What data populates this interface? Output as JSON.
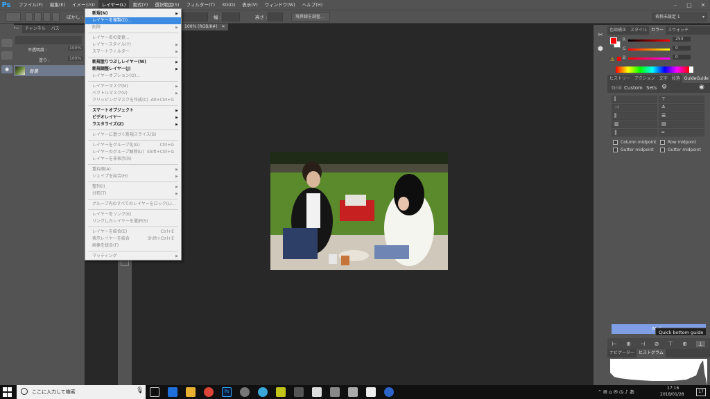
{
  "app": {
    "logo": "Ps",
    "menus": [
      "ファイル(F)",
      "編集(E)",
      "イメージ(I)",
      "レイヤー(L)",
      "書式(Y)",
      "選択範囲(S)",
      "フィルター(T)",
      "3D(D)",
      "表示(V)",
      "ウィンドウ(W)",
      "ヘルプ(H)"
    ],
    "active_menu": "レイヤー(L)"
  },
  "optbar": {
    "blur_label": "ぼかし :",
    "width_label": "幅 :",
    "height_label": "高さ :",
    "refine_edge": "境界線を調整...",
    "workspace": "名称未設定 1"
  },
  "left_panel": {
    "tabs": [
      "レイヤー",
      "チャンネル",
      "パス"
    ],
    "opacity_label": "不透明度 :",
    "opacity_value": "100%",
    "fill_label": "塗り :",
    "fill_value": "100%",
    "layer_name": "背景"
  },
  "document_tab": "100% (RGB/8#)",
  "layer_menu": {
    "items": [
      {
        "label": "新規(N)",
        "type": "bold",
        "arrow": true
      },
      {
        "label": "レイヤーを複製(D)...",
        "type": "hi"
      },
      {
        "label": "削除",
        "type": "dis",
        "arrow": true
      },
      {
        "type": "sep"
      },
      {
        "label": "レイヤー名の変更...",
        "type": "dis"
      },
      {
        "label": "レイヤースタイル(Y)",
        "type": "dis",
        "arrow": true
      },
      {
        "label": "スマートフィルター",
        "type": "dis",
        "arrow": true
      },
      {
        "type": "sep"
      },
      {
        "label": "新規塗りつぶしレイヤー(W)",
        "type": "bold",
        "arrow": true
      },
      {
        "label": "新規調整レイヤー(J)",
        "type": "bold",
        "arrow": true
      },
      {
        "label": "レイヤーオプション(O)...",
        "type": "dis"
      },
      {
        "type": "sep"
      },
      {
        "label": "レイヤーマスク(M)",
        "type": "dis",
        "arrow": true
      },
      {
        "label": "ベクトルマスク(V)",
        "type": "dis",
        "arrow": true
      },
      {
        "label": "クリッピングマスクを作成(C)",
        "type": "dis",
        "shortcut": "Alt+Ctrl+G"
      },
      {
        "type": "sep"
      },
      {
        "label": "スマートオブジェクト",
        "type": "bold",
        "arrow": true
      },
      {
        "label": "ビデオレイヤー",
        "type": "bold",
        "arrow": true
      },
      {
        "label": "ラスタライズ(Z)",
        "type": "bold",
        "arrow": true
      },
      {
        "type": "sep"
      },
      {
        "label": "レイヤーに基づく新規スライス(B)",
        "type": "dis"
      },
      {
        "type": "sep"
      },
      {
        "label": "レイヤーをグループ化(G)",
        "type": "dis",
        "shortcut": "Ctrl+G"
      },
      {
        "label": "レイヤーのグループ解除(U)",
        "type": "dis",
        "shortcut": "Shift+Ctrl+G"
      },
      {
        "label": "レイヤーを非表示(R)",
        "type": "dis"
      },
      {
        "type": "sep"
      },
      {
        "label": "重ね順(A)",
        "type": "dis",
        "arrow": true
      },
      {
        "label": "シェイプを結合(H)",
        "type": "dis",
        "arrow": true
      },
      {
        "type": "sep"
      },
      {
        "label": "整列(I)",
        "type": "dis",
        "arrow": true
      },
      {
        "label": "分布(T)",
        "type": "dis",
        "arrow": true
      },
      {
        "type": "sep"
      },
      {
        "label": "グループ内のすべてのレイヤーをロック(L)...",
        "type": "dis"
      },
      {
        "type": "sep"
      },
      {
        "label": "レイヤーをリンク(K)",
        "type": "dis"
      },
      {
        "label": "リンクしたレイヤーを選択(S)",
        "type": "dis"
      },
      {
        "type": "sep"
      },
      {
        "label": "レイヤーを結合(E)",
        "type": "dis",
        "shortcut": "Ctrl+E"
      },
      {
        "label": "表示レイヤーを結合",
        "type": "dis",
        "shortcut": "Shift+Ctrl+E"
      },
      {
        "label": "画像を統合(F)",
        "type": "dis"
      },
      {
        "type": "sep"
      },
      {
        "label": "マッティング",
        "type": "dis",
        "arrow": true
      }
    ]
  },
  "color_panel": {
    "tabs": [
      "色調補正",
      "スタイル",
      "カラー",
      "スウォッチ"
    ],
    "active_tab": "カラー",
    "r_label": "R",
    "r_value": "253",
    "g_label": "G",
    "g_value": "0",
    "b_label": "B",
    "b_value": "0",
    "foreground": "#fd0000"
  },
  "guide_panel": {
    "tabs": [
      "ヒストリー",
      "アクション",
      "文字",
      "段落",
      "GuideGuide"
    ],
    "active_tab": "GuideGuide",
    "header": [
      "Grid",
      "Custom",
      "Sets"
    ],
    "checkboxes": [
      "Column midpoint",
      "Row midpoint",
      "Gutter midpoint",
      "Gutter midpoint"
    ],
    "make_button": "Make",
    "tooltip": "Quick bottom guide"
  },
  "bottom_panel": {
    "tabs": [
      "ナビゲーター",
      "ヒストグラム"
    ],
    "active_tab": "ヒストグラム"
  },
  "taskbar": {
    "search_placeholder": "ここに入力して検索",
    "time": "17:16",
    "date": "2018/01/28",
    "badge": "17"
  }
}
